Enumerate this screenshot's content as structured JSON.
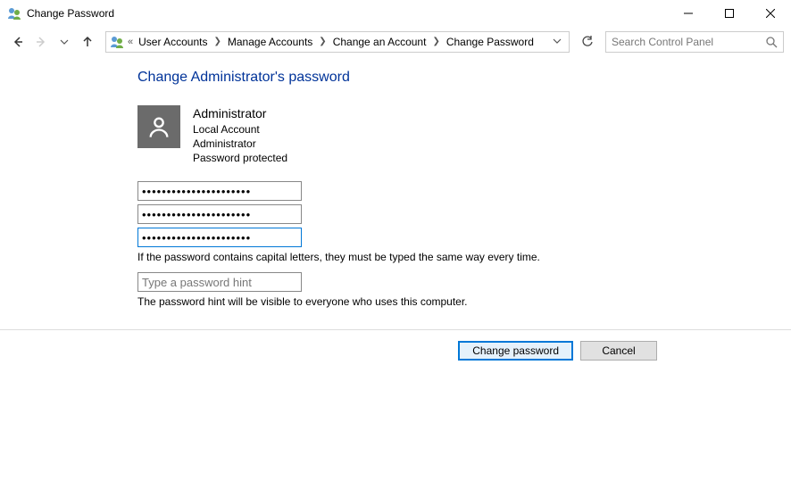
{
  "window": {
    "title": "Change Password"
  },
  "breadcrumb": {
    "items": [
      {
        "label": "User Accounts"
      },
      {
        "label": "Manage Accounts"
      },
      {
        "label": "Change an Account"
      },
      {
        "label": "Change Password"
      }
    ]
  },
  "search": {
    "placeholder": "Search Control Panel"
  },
  "page": {
    "heading": "Change Administrator's password",
    "account_name": "Administrator",
    "account_type": "Local Account",
    "account_role": "Administrator",
    "account_status": "Password protected",
    "current_password_value": "••••••••••••••••••••••",
    "new_password_value": "••••••••••••••••••••••",
    "confirm_password_value": "••••••••••••••••••••••",
    "capital_note": "If the password contains capital letters, they must be typed the same way every time.",
    "hint_placeholder": "Type a password hint",
    "hint_note": "The password hint will be visible to everyone who uses this computer.",
    "primary_button": "Change password",
    "cancel_button": "Cancel"
  }
}
